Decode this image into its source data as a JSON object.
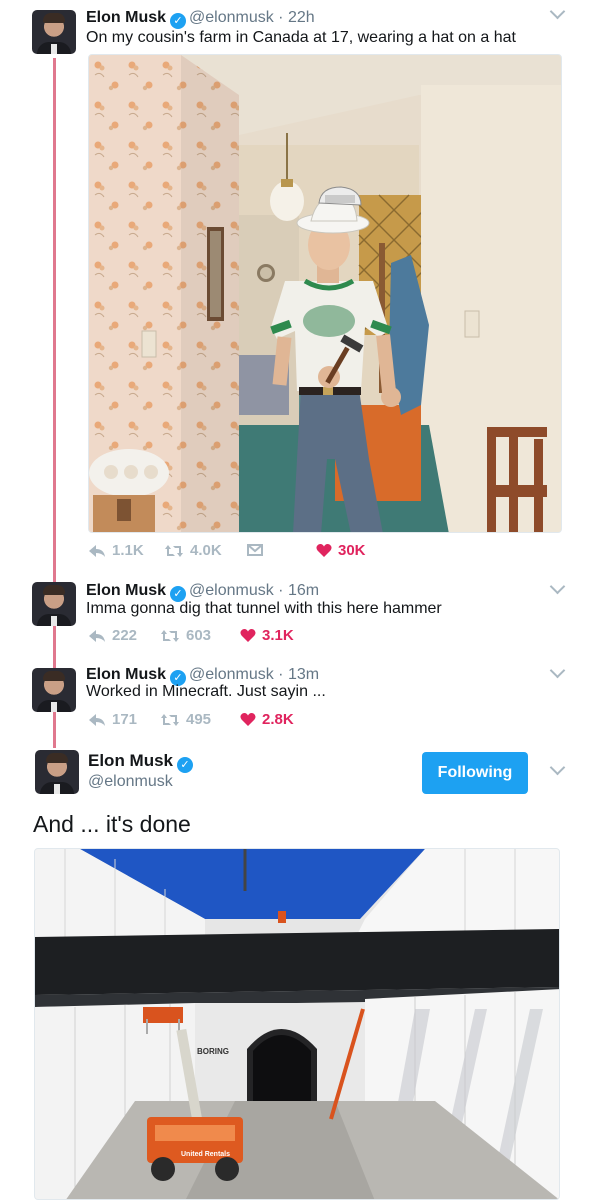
{
  "tweets": [
    {
      "name": "Elon Musk",
      "handle": "@elonmusk",
      "time": "22h",
      "text": "On my cousin's farm in Canada at 17, wearing a hat on a hat",
      "replies": "1.1K",
      "retweets": "4.0K",
      "likes": "30K"
    },
    {
      "name": "Elon Musk",
      "handle": "@elonmusk",
      "time": "16m",
      "text": "Imma gonna dig that tunnel with this here hammer",
      "replies": "222",
      "retweets": "603",
      "likes": "3.1K"
    },
    {
      "name": "Elon Musk",
      "handle": "@elonmusk",
      "time": "13m",
      "text": "Worked in Minecraft. Just sayin ...",
      "replies": "171",
      "retweets": "495",
      "likes": "2.8K"
    }
  ],
  "main_tweet": {
    "name": "Elon Musk",
    "handle": "@elonmusk",
    "follow_label": "Following",
    "text": "And ... it's done"
  },
  "photo_signs": {
    "boring": "BORING",
    "rentals": "United Rentals"
  },
  "colors": {
    "accent": "#1da1f2",
    "like": "#e0245e",
    "thread": "#e0788e",
    "muted": "#657786"
  }
}
